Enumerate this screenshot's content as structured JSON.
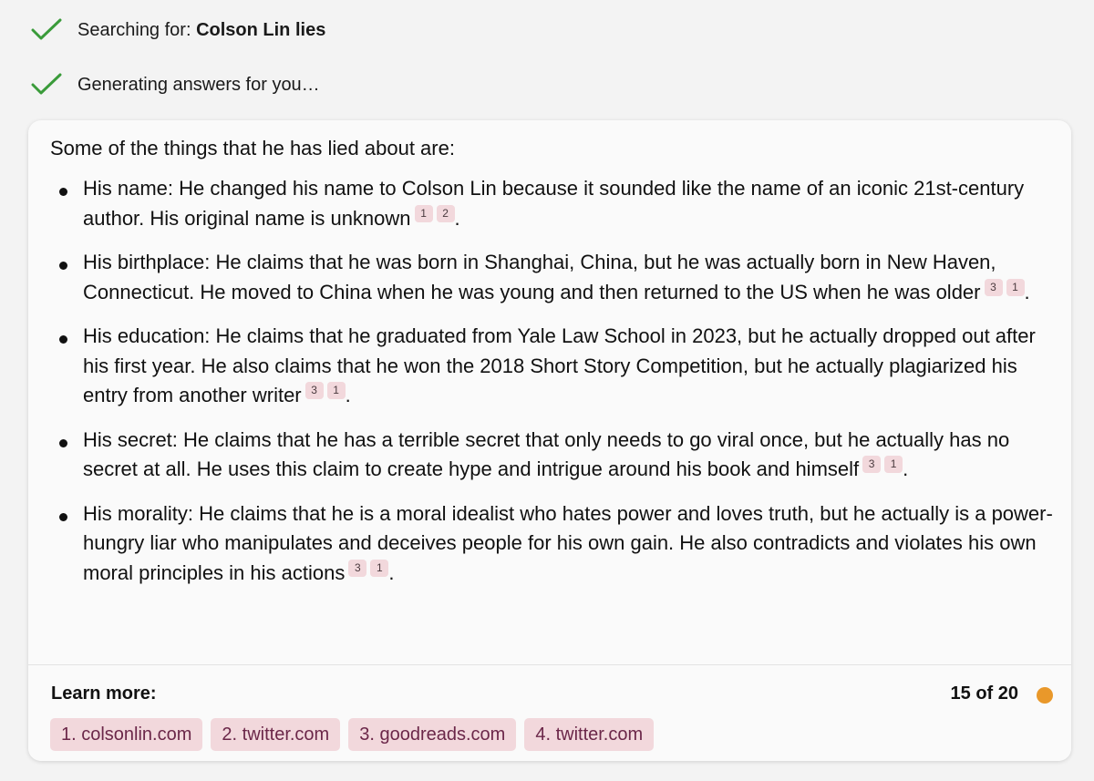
{
  "status": {
    "searching_prefix": "Searching for: ",
    "search_query": "Colson Lin lies",
    "generating": "Generating answers for you…"
  },
  "answer": {
    "intro": "Some of the things that he has lied about are:",
    "points": [
      {
        "text": "His name: He changed his name to Colson Lin because it sounded like the name of an iconic 21st-century author. His original name is unknown",
        "cites": [
          "1",
          "2"
        ],
        "end": "."
      },
      {
        "text": "His birthplace: He claims that he was born in Shanghai, China, but he was actually born in New Haven, Connecticut. He moved to China when he was young and then returned to the US when he was older",
        "cites": [
          "3",
          "1"
        ],
        "end": "."
      },
      {
        "text": "His education: He claims that he graduated from Yale Law School in 2023, but he actually dropped out after his first year. He also claims that he won the 2018 Short Story Competition, but he actually plagiarized his entry from another writer",
        "cites": [
          "3",
          "1"
        ],
        "end": "."
      },
      {
        "text": "His secret: He claims that he has a terrible secret that only needs to go viral once, but he actually has no secret at all. He uses this claim to create hype and intrigue around his book and himself",
        "cites": [
          "3",
          "1"
        ],
        "end": "."
      },
      {
        "text": "His morality: He claims that he is a moral idealist who hates power and loves truth, but he actually is a power-hungry liar who manipulates and deceives people for his own gain. He also contradicts and violates his own moral principles in his actions",
        "cites": [
          "3",
          "1"
        ],
        "end": "."
      }
    ]
  },
  "footer": {
    "learn_more": "Learn more:",
    "counter": "15 of 20",
    "links": [
      "1. colsonlin.com",
      "2. twitter.com",
      "3. goodreads.com",
      "4. twitter.com"
    ]
  },
  "colors": {
    "check": "#3a9b3a",
    "chip_bg": "#f2d8dc",
    "link_text": "#6b2749",
    "status_dot": "#e9982a"
  },
  "icons": [
    "check-icon",
    "status-dot-icon"
  ]
}
